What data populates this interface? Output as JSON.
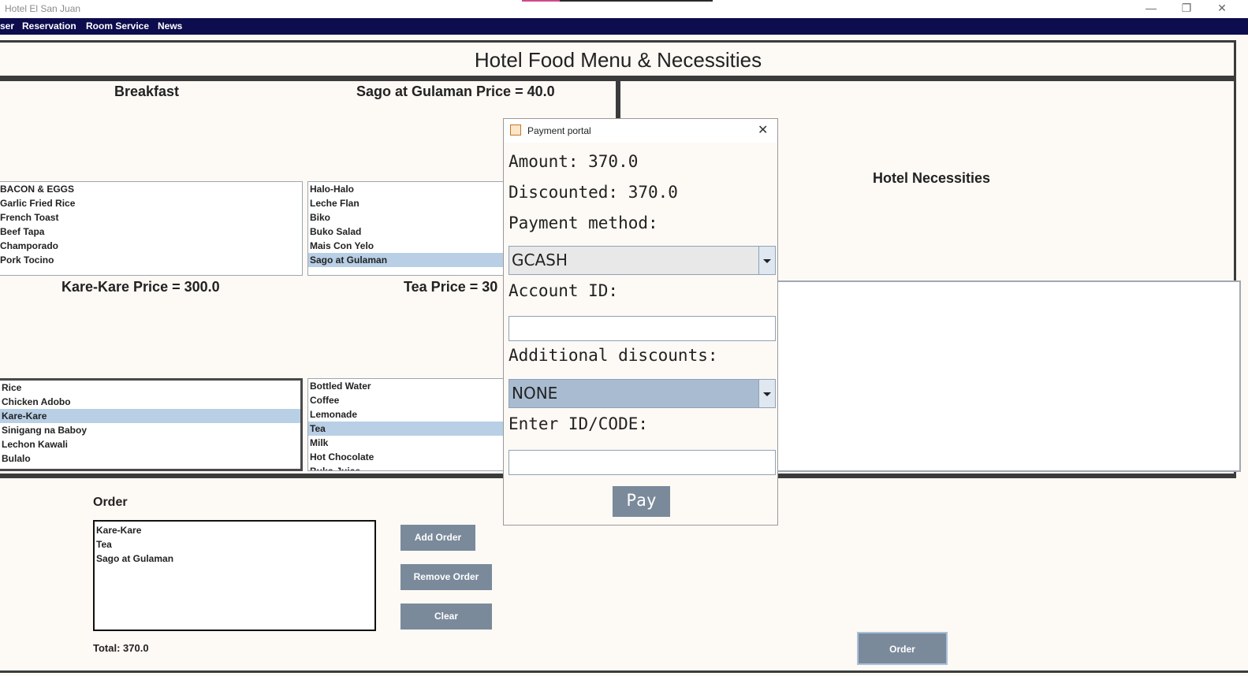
{
  "window": {
    "title": "Hotel El San Juan"
  },
  "menu": [
    "ser",
    "Reservation",
    "Room Service",
    "News"
  ],
  "header": {
    "title": "Hotel Food Menu & Necessities"
  },
  "sections": {
    "breakfast_label": "Breakfast",
    "top_price_label": "Sago at Gulaman Price = 40.0",
    "lunch_price_label": "Kare-Kare Price = 300.0",
    "drinks_price_label": "Tea Price = 30",
    "necessities_label": "Hotel Necessities"
  },
  "lists": {
    "breakfast": [
      {
        "label": "BACON & EGGS",
        "selected": false
      },
      {
        "label": "Garlic Fried Rice",
        "selected": false
      },
      {
        "label": "French Toast",
        "selected": false
      },
      {
        "label": "Beef Tapa",
        "selected": false
      },
      {
        "label": "Champorado",
        "selected": false
      },
      {
        "label": "Pork Tocino",
        "selected": false
      }
    ],
    "desserts": [
      {
        "label": "Halo-Halo",
        "selected": false
      },
      {
        "label": "Leche Flan",
        "selected": false
      },
      {
        "label": "Biko",
        "selected": false
      },
      {
        "label": "Buko Salad",
        "selected": false
      },
      {
        "label": "Mais Con Yelo",
        "selected": false
      },
      {
        "label": "Sago at Gulaman",
        "selected": true
      }
    ],
    "lunch": [
      {
        "label": "Rice",
        "selected": false
      },
      {
        "label": "Chicken Adobo",
        "selected": false
      },
      {
        "label": "Kare-Kare",
        "selected": true
      },
      {
        "label": "Sinigang na Baboy",
        "selected": false
      },
      {
        "label": "Lechon Kawali",
        "selected": false
      },
      {
        "label": "Bulalo",
        "selected": false
      }
    ],
    "drinks": [
      {
        "label": "Bottled Water",
        "selected": false
      },
      {
        "label": "Coffee",
        "selected": false
      },
      {
        "label": "Lemonade",
        "selected": false
      },
      {
        "label": "Tea",
        "selected": true
      },
      {
        "label": "Milk",
        "selected": false
      },
      {
        "label": "Hot Chocolate",
        "selected": false
      },
      {
        "label": "Buko Juice",
        "selected": false
      }
    ]
  },
  "order": {
    "label": "Order",
    "items": [
      "Kare-Kare",
      "Tea",
      "Sago at Gulaman"
    ],
    "add_label": "Add Order",
    "remove_label": "Remove Order",
    "clear_label": "Clear",
    "total": "Total: 370.0",
    "order_button": "Order"
  },
  "dialog": {
    "title": "Payment portal",
    "amount": "Amount: 370.0",
    "discounted": "Discounted: 370.0",
    "payment_method_label": "Payment method:",
    "payment_method_value": "GCASH",
    "account_id_label": "Account ID:",
    "account_id_value": "",
    "additional_discounts_label": "Additional discounts:",
    "additional_discounts_value": "NONE",
    "id_code_label": "Enter ID/CODE:",
    "id_code_value": "",
    "pay_label": "Pay"
  }
}
